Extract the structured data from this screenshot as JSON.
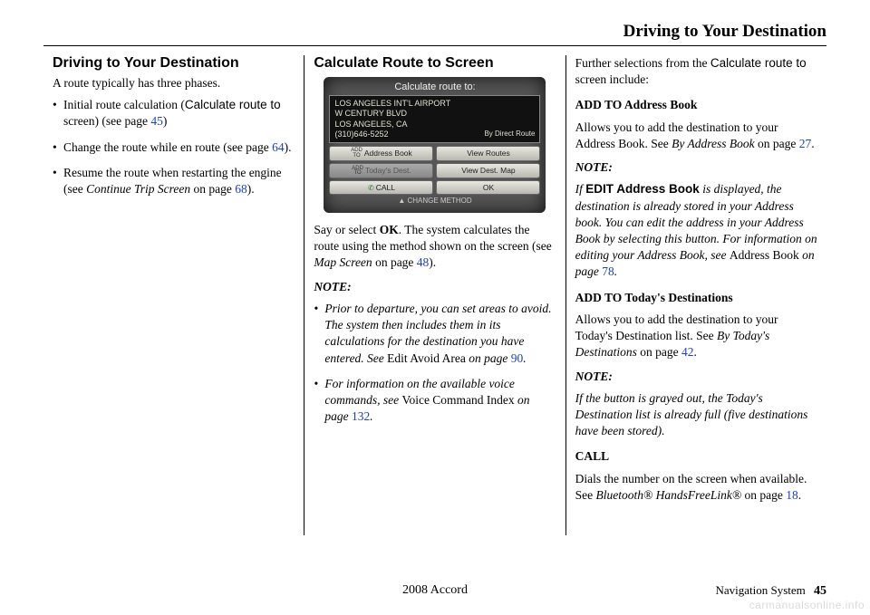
{
  "header": {
    "title": "Driving to Your Destination"
  },
  "col1": {
    "heading": "Driving to Your Destination",
    "intro": "A route typically has three phases.",
    "items": [
      {
        "pre": "Initial route calculation (",
        "sans": "Calculate route to",
        "post": " screen) (see page ",
        "page": "45",
        "tail": ")"
      },
      {
        "text": "Change the route while en route (see page ",
        "page": "64",
        "tail": ")."
      },
      {
        "pre": "Resume the route when restarting the engine (see ",
        "ital": "Continue Trip Screen",
        "post": " on page ",
        "page": "68",
        "tail": ")."
      }
    ]
  },
  "col2": {
    "heading": "Calculate Route to Screen",
    "screen": {
      "title": "Calculate route to:",
      "line1": "LOS ANGELES INT'L AIRPORT",
      "line2": "W CENTURY BLVD",
      "line3": "LOS ANGELES, CA",
      "line4": "(310)646-5252",
      "byroute": "By Direct Route",
      "btn_addr": "Address Book",
      "btn_view": "View Routes",
      "btn_today": "Today's Dest.",
      "btn_map": "View Dest. Map",
      "btn_call": "CALL",
      "btn_ok": "OK",
      "footer": "▲ CHANGE METHOD"
    },
    "p1a": "Say or select ",
    "p1b": "OK",
    "p1c": ". The system calculates the route using the method shown on the screen (see ",
    "p1d": "Map Screen",
    "p1e": " on page ",
    "p1page": "48",
    "p1f": ").",
    "note_label": "NOTE:",
    "notes": [
      {
        "pre": "Prior to departure, you can set areas to avoid. The system then includes them in its calculations for the destination you have entered. See ",
        "roman": "Edit Avoid Area",
        "post": " on page ",
        "page": "90",
        "tail": "."
      },
      {
        "pre": "For information on the available voice commands, see ",
        "roman": "Voice Command Index",
        "post": " on page ",
        "page": "132",
        "tail": "."
      }
    ]
  },
  "col3": {
    "intro_a": "Further selections from the ",
    "intro_b": "Calculate route to",
    "intro_c": " screen include:",
    "addr_h": "ADD TO Address Book",
    "addr_p_a": "Allows you to add the destination to your Address Book. See ",
    "addr_p_b": "By Address Book",
    "addr_p_c": " on page ",
    "addr_page": "27",
    "addr_p_d": ".",
    "note_label": "NOTE:",
    "note1_a": "If ",
    "note1_b": "EDIT Address Book",
    "note1_c": " is displayed, the destination is already stored in your Address book. You can edit the address in your Address Book by selecting this button. For information on editing your Address Book, see ",
    "note1_d": "Address Book",
    "note1_e": " on page ",
    "note1_page": "78",
    "note1_f": ".",
    "today_h": "ADD TO Today's Destinations",
    "today_a": "Allows you to add the destination to your Today's Destination list. See ",
    "today_b": "By Today's Destinations",
    "today_c": " on page ",
    "today_page": "42",
    "today_d": ".",
    "note2": "If the button is grayed out, the Today's Destination list is already full (five destinations have been stored).",
    "call_h": "CALL",
    "call_a": "Dials the number on the screen when available. See ",
    "call_b": "Bluetooth® HandsFreeLink®",
    "call_c": " on page ",
    "call_page": "18",
    "call_d": "."
  },
  "footer": {
    "center": "2008  Accord",
    "right_label": "Navigation System",
    "page": "45"
  },
  "watermark": "carmanualsonline.info"
}
